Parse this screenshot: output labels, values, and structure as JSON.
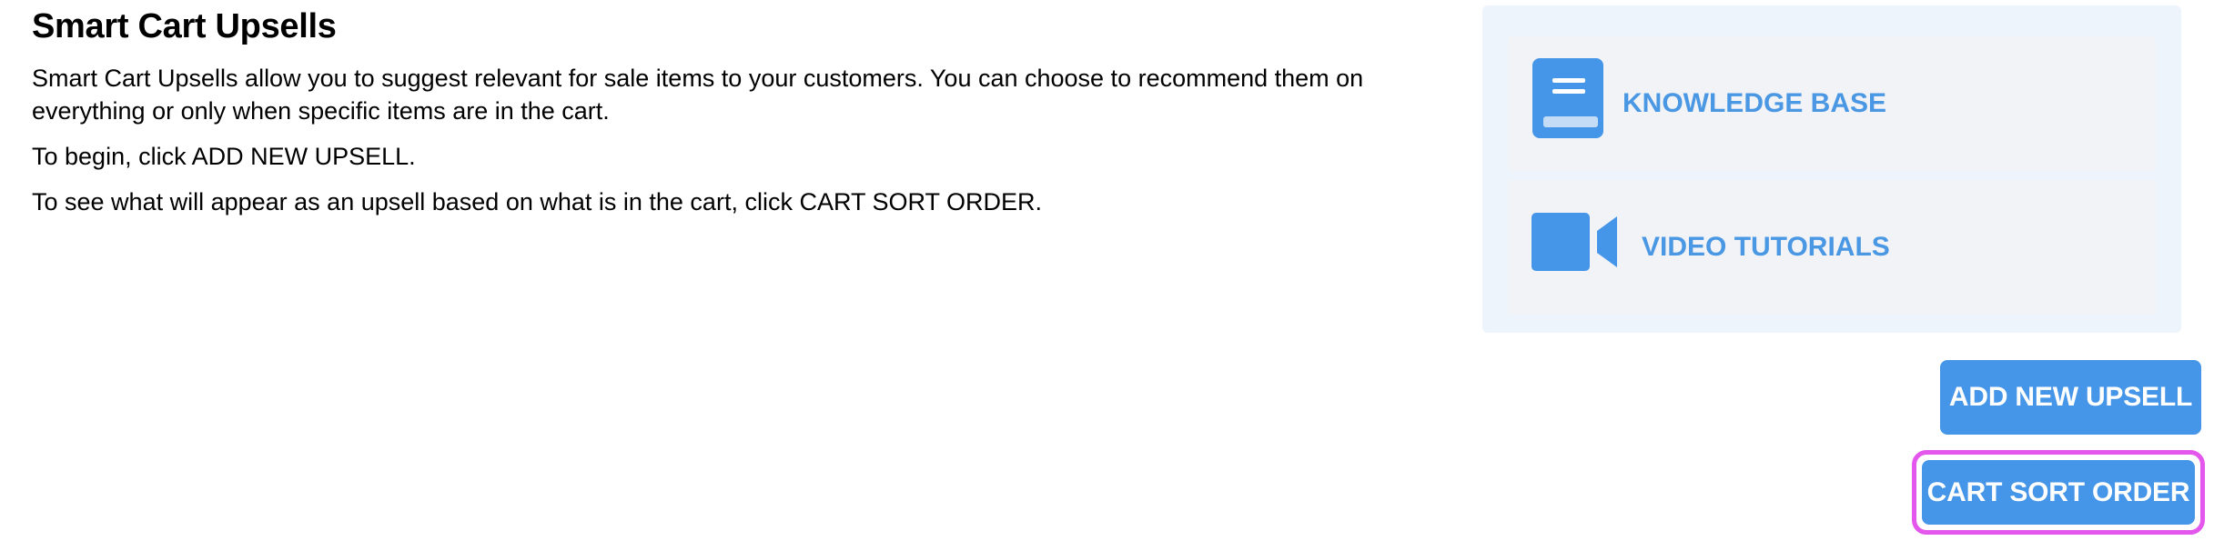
{
  "page": {
    "title": "Smart Cart Upsells",
    "paragraphs": {
      "intro": "Smart Cart Upsells allow you to suggest relevant for sale items to your customers. You can choose to recommend them on everything or only when specific items are in the cart.",
      "begin": "To begin, click ADD NEW UPSELL.",
      "preview": "To see what will appear as an upsell based on what is in the cart, click CART SORT ORDER."
    }
  },
  "resources": {
    "knowledge_base": {
      "label": "KNOWLEDGE BASE",
      "icon": "book-icon"
    },
    "video_tutorials": {
      "label": "VIDEO TUTORIALS",
      "icon": "video-camera-icon"
    }
  },
  "actions": {
    "add_new_upsell": "ADD NEW UPSELL",
    "cart_sort_order": "CART SORT ORDER"
  },
  "colors": {
    "accent": "#4595e8",
    "link_text": "#4a97e4",
    "panel_bg": "#eef4fb",
    "card_bg": "#f1f3f6",
    "focus_ring": "#e457ec"
  }
}
